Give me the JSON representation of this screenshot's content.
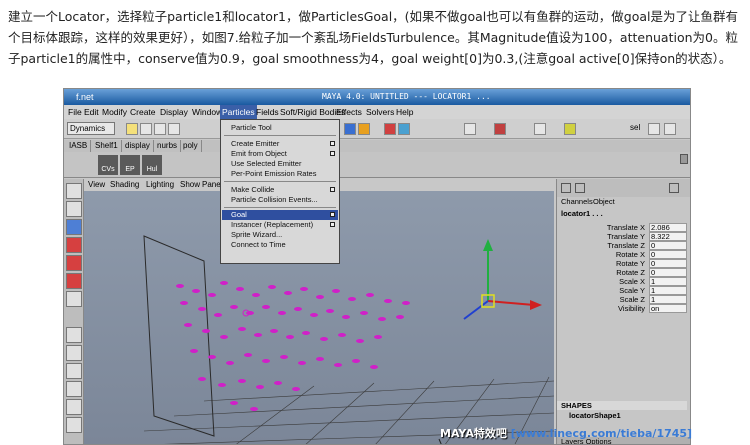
{
  "article": {
    "paragraph": "建立一个Locator，选择粒子particle1和locator1，做ParticlesGoal，(如果不做goal也可以有鱼群的运动，做goal是为了让鱼群有个目标体跟踪，这样的效果更好），如图7.给粒子加一个紊乱场FieldsTurbulence。其Magnitude值设为100，attenuation为0。粒子particle1的属性中，conserve值为0.9，goal smoothness为4，goal weight[0]为0.3,(注意goal active[0]保持on的状态）。"
  },
  "window": {
    "title": "f.net",
    "center_title": "MAYA 4.0: UNTITLED  ---  LOCATOR1 ..."
  },
  "menubar": [
    "File",
    "Edit",
    "Modify",
    "Create",
    "Display",
    "Window",
    "Particles",
    "Fields",
    "Soft/Rigid Bodies",
    "Effects",
    "Solvers",
    "Help"
  ],
  "toolbar": {
    "mode_dropdown": "Dynamics",
    "tool_right_label": "sel"
  },
  "shelf": {
    "tabs": [
      "IASB",
      "Shelf1",
      "display",
      "nurbs",
      "poly"
    ],
    "buttons": [
      "CVs",
      "EP",
      "Hul"
    ]
  },
  "panel_menu": [
    "View",
    "Shading",
    "Lighting",
    "Show",
    "Panels"
  ],
  "particles_menu": {
    "items": [
      {
        "label": "Particle Tool",
        "option": false
      },
      {
        "label": "Create Emitter",
        "option": true
      },
      {
        "label": "Emit from Object",
        "option": true
      },
      {
        "label": "Use Selected Emitter",
        "option": false
      },
      {
        "label": "Per-Point Emission Rates",
        "option": false
      },
      {
        "label": "Make Collide",
        "option": true
      },
      {
        "label": "Particle Collision Events...",
        "option": false
      },
      {
        "label": "Goal",
        "option": true,
        "selected": true
      },
      {
        "label": "Instancer (Replacement)",
        "option": true
      },
      {
        "label": "Sprite Wizard...",
        "option": false
      },
      {
        "label": "Connect to Time",
        "option": false
      }
    ]
  },
  "channel_box": {
    "tabs": [
      "Channels",
      "Object"
    ],
    "object_name": "locator1 . . .",
    "attributes": [
      {
        "name": "Translate X",
        "value": "2.086"
      },
      {
        "name": "Translate Y",
        "value": "8.322"
      },
      {
        "name": "Translate Z",
        "value": "0"
      },
      {
        "name": "Rotate X",
        "value": "0"
      },
      {
        "name": "Rotate Y",
        "value": "0"
      },
      {
        "name": "Rotate Z",
        "value": "0"
      },
      {
        "name": "Scale X",
        "value": "1"
      },
      {
        "name": "Scale Y",
        "value": "1"
      },
      {
        "name": "Scale Z",
        "value": "1"
      },
      {
        "name": "Visibility",
        "value": "on"
      }
    ],
    "shapes_header": "SHAPES",
    "shape_name": "locatorShape1",
    "layers_label": "Layers  Options"
  },
  "watermark": {
    "text": "MAYA特效吧",
    "url": "[www.linecg.com/tieba/1745]"
  },
  "colors": {
    "particle": "#d020c8",
    "selection": "#2f4f9f",
    "viewport": "#8492a4"
  }
}
